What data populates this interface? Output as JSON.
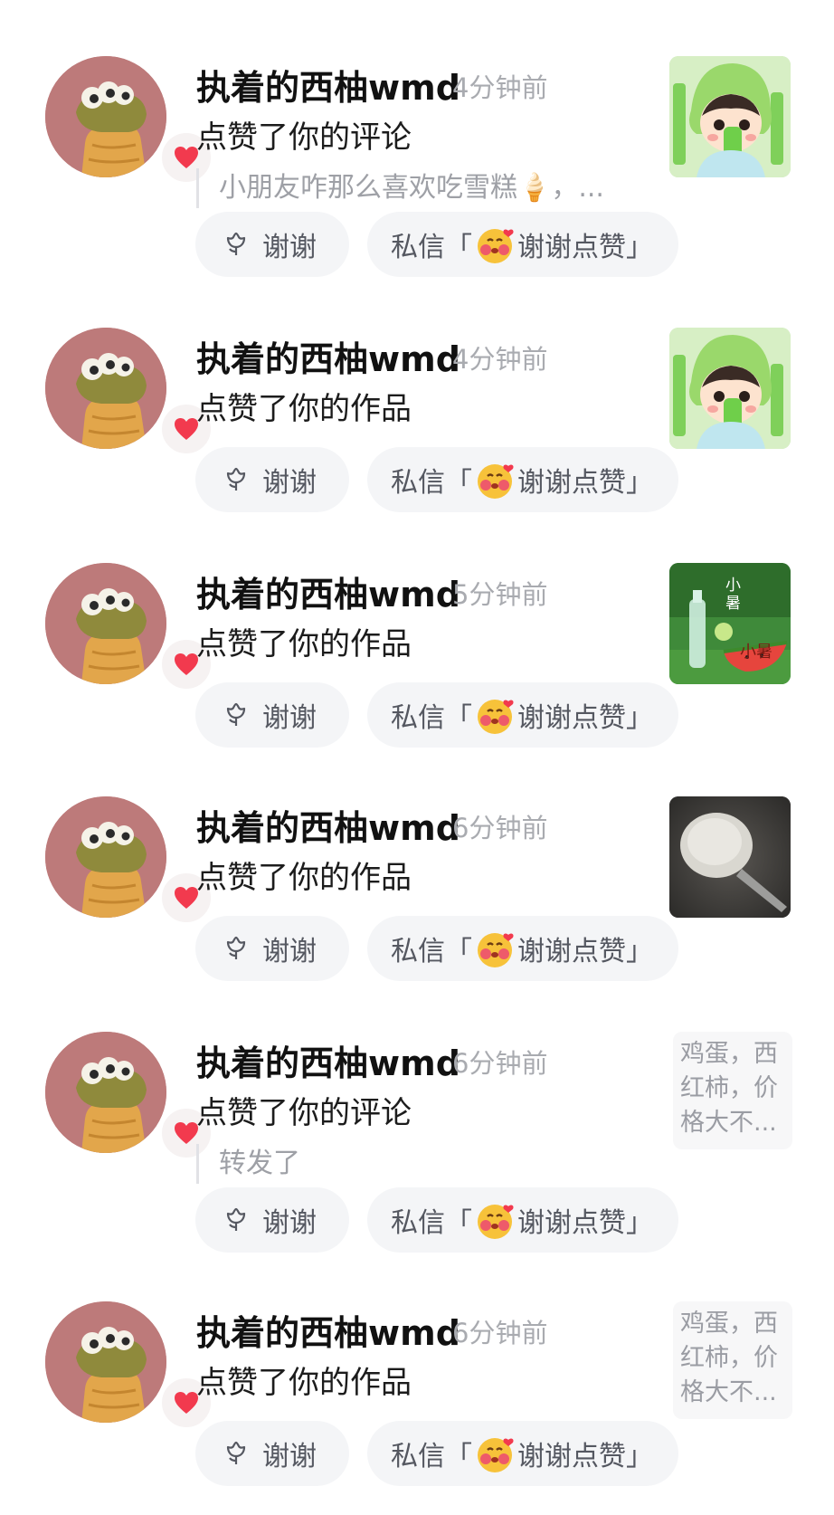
{
  "buttons": {
    "thanks": "谢谢",
    "dm_prefix": "私信「",
    "dm_text": "谢谢点赞",
    "dm_suffix": "」"
  },
  "colors": {
    "heart": "#f23a4e",
    "avatar_bg": "#bd7a7a",
    "button_bg": "#f4f5f7"
  },
  "notifications": [
    {
      "user": "执着的西柚wmd",
      "time": "4分钟前",
      "action": "点赞了你的评论",
      "quote": "小朋友咋那么喜欢吃雪糕🍦，...",
      "thumb": "girl-popsicle"
    },
    {
      "user": "执着的西柚wmd",
      "time": "4分钟前",
      "action": "点赞了你的作品",
      "quote": null,
      "thumb": "girl-popsicle"
    },
    {
      "user": "执着的西柚wmd",
      "time": "5分钟前",
      "action": "点赞了你的作品",
      "quote": null,
      "thumb": "watermelon-soda",
      "thumb_text": [
        "小",
        "暑",
        "小暑"
      ]
    },
    {
      "user": "执着的西柚wmd",
      "time": "6分钟前",
      "action": "点赞了你的作品",
      "quote": null,
      "thumb": "rice-spoon"
    },
    {
      "user": "执着的西柚wmd",
      "time": "6分钟前",
      "action": "点赞了你的评论",
      "quote": "转发了",
      "thumb": "text",
      "thumb_lines": [
        "鸡蛋，西",
        "红柿，价",
        "格大不..."
      ]
    },
    {
      "user": "执着的西柚wmd",
      "time": "6分钟前",
      "action": "点赞了你的作品",
      "quote": null,
      "thumb": "text",
      "thumb_lines": [
        "鸡蛋，西",
        "红柿，价",
        "格大不..."
      ]
    }
  ]
}
